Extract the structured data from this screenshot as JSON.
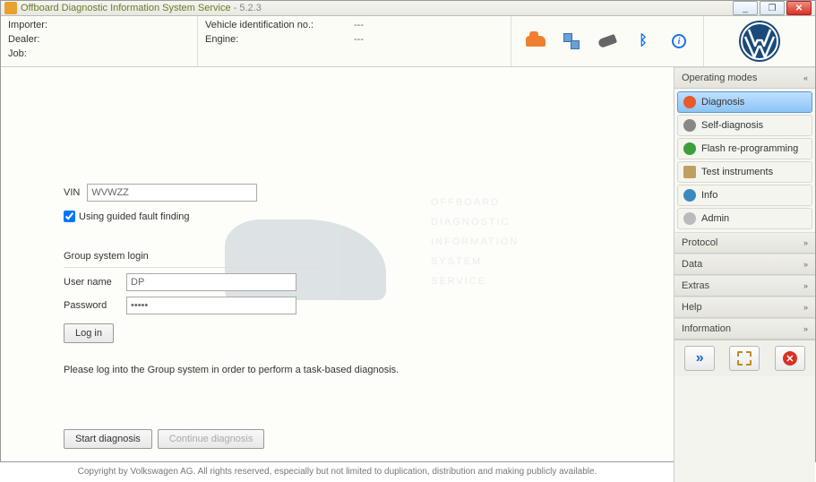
{
  "title": {
    "app": "Offboard Diagnostic Information System Service",
    "version": "5.2.3"
  },
  "header": {
    "left": {
      "importer": {
        "label": "Importer:",
        "value": ""
      },
      "dealer": {
        "label": "Dealer:",
        "value": ""
      },
      "job": {
        "label": "Job:",
        "value": ""
      }
    },
    "right": {
      "vin": {
        "label": "Vehicle identification no.:",
        "value": "---"
      },
      "engine": {
        "label": "Engine:",
        "value": "---"
      }
    }
  },
  "content": {
    "vin_label": "VIN",
    "vin_value": "WVWZZ",
    "guided_chk_label": "Using guided fault finding",
    "login": {
      "title": "Group system login",
      "user_label": "User name",
      "user_value": "DP",
      "pass_label": "Password",
      "pass_value": "•••••",
      "login_btn": "Log in"
    },
    "message": "Please log into the Group system in order to perform a task-based diagnosis.",
    "start_btn": "Start diagnosis",
    "continue_btn": "Continue diagnosis",
    "copyright": "Copyright by Volkswagen AG. All rights reserved, especially but not limited to duplication, distribution and making publicly available."
  },
  "watermark": {
    "l1": "OFFBOARD",
    "l2": "DIAGNOSTIC",
    "l3": "INFORMATION",
    "l4": "SYSTEM",
    "l5": "SERVICE"
  },
  "side": {
    "sections": {
      "modes": "Operating modes",
      "protocol": "Protocol",
      "data": "Data",
      "extras": "Extras",
      "help": "Help",
      "information": "Information"
    },
    "modes": {
      "diagnosis": "Diagnosis",
      "self": "Self-diagnosis",
      "flash": "Flash re-programming",
      "test": "Test instruments",
      "info": "Info",
      "admin": "Admin"
    }
  }
}
